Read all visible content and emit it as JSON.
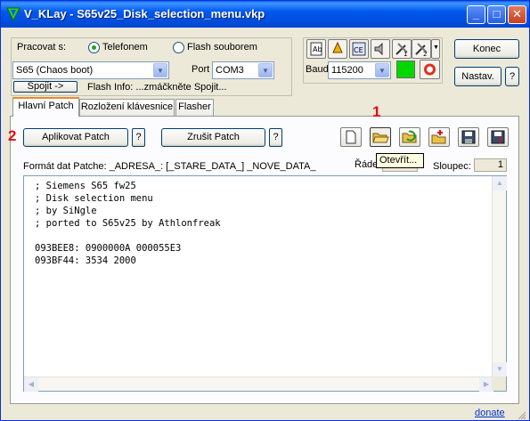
{
  "window": {
    "title": "V_KLay - S65v25_Disk_selection_menu.vkp",
    "controls": [
      "minimize-icon",
      "maximize-icon",
      "close-icon"
    ]
  },
  "connection": {
    "label": "Pracovat s:",
    "radio_phone": "Telefonem",
    "radio_flash": "Flash souborem",
    "selected": "Telefonem",
    "model_value": "S65 (Chaos boot)",
    "port_label": "Port",
    "port_value": "COM3",
    "connect_button": "Spojit ->",
    "flash_info": "Flash Info: ...zmáčkněte Spojit..."
  },
  "baud": {
    "label": "Baud",
    "value": "115200",
    "status_color": "#00d800"
  },
  "right_buttons": {
    "end": "Konec",
    "settings": "Nastav.",
    "help": "?"
  },
  "tabs": [
    {
      "label": "Hlavní Patch",
      "active": true
    },
    {
      "label": "Rozložení klávesnice",
      "active": false
    },
    {
      "label": "Flasher",
      "active": false
    }
  ],
  "patch": {
    "apply_button": "Aplikovat Patch",
    "apply_help": "?",
    "cancel_button": "Zrušit Patch",
    "cancel_help": "?",
    "format_label": "Formát dat Patche: _ADRESA_: [_STARE_DATA_] _NOVE_DATA_",
    "row_label": "Řádek",
    "col_label": "Sloupec:",
    "col_value": "1",
    "tooltip": "Otevřít...",
    "content": "; Siemens S65 fw25\n; Disk selection menu\n; by SiNgle\n; ported to S65v25 by Athlonfreak\n\n093BEE8: 0900000A 000055E3\n093BF44: 3534 2000"
  },
  "toolbar_icons": [
    "new-file-icon",
    "open-folder-icon",
    "refresh-folder-icon",
    "add-folder-icon",
    "save-icon",
    "save-as-icon"
  ],
  "annotations": {
    "marker1": "1",
    "marker2": "2",
    "marker_color": "#e01010"
  },
  "status": {
    "donate": "donate"
  }
}
